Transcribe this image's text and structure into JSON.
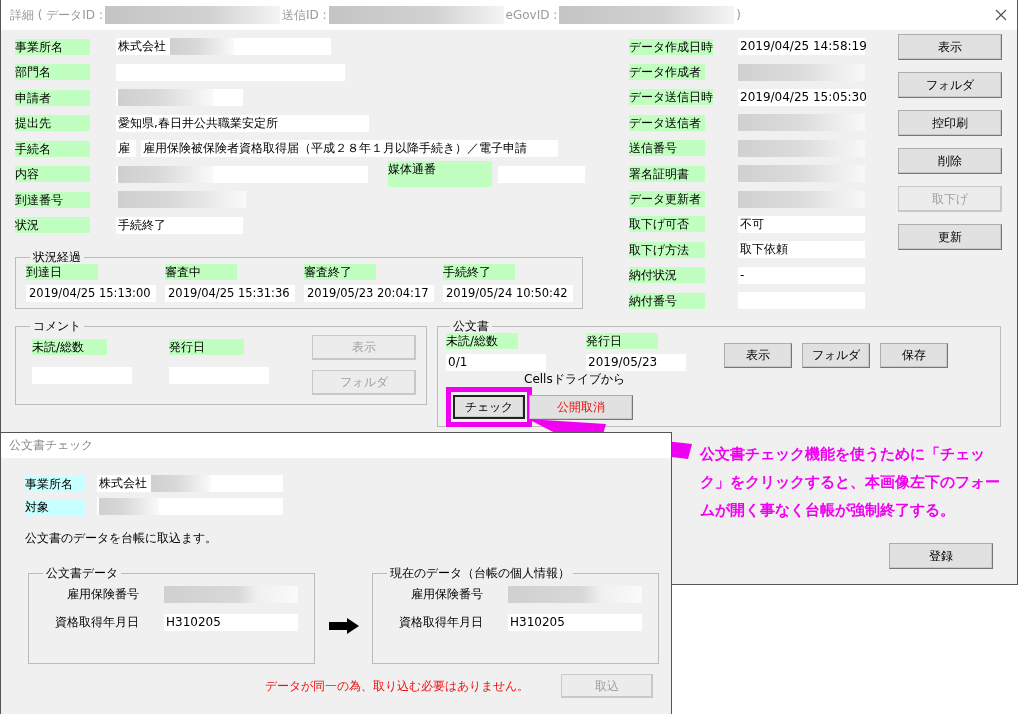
{
  "window": {
    "title_parts": [
      {
        "kind": "text",
        "text": "詳細 ( データID :"
      },
      {
        "kind": "redacted"
      },
      {
        "kind": "text",
        "text": "送信ID :"
      },
      {
        "kind": "redacted"
      },
      {
        "kind": "text",
        "text": "eGovID :"
      },
      {
        "kind": "redacted"
      },
      {
        "kind": "text",
        "text": ")"
      }
    ]
  },
  "left_fields": [
    {
      "label": "事業所名",
      "value": "株式会社",
      "redacted": true
    },
    {
      "label": "部門名"
    },
    {
      "label": "申請者",
      "redacted": true
    },
    {
      "label": "提出先",
      "value": "愛知県,春日井公共職業安定所"
    },
    {
      "label": "手続名",
      "code": "雇",
      "value": "雇用保険被保険者資格取得届（平成２８年１月以降手続き）／電子申請"
    },
    {
      "label": "内容",
      "redacted": true,
      "side_label": "媒体通番"
    },
    {
      "label": "到達番号",
      "redacted": true
    },
    {
      "label": "状況",
      "value": "手続終了"
    }
  ],
  "right_fields": [
    {
      "label": "データ作成日時",
      "value": "2019/04/25 14:58:19"
    },
    {
      "label": "データ作成者",
      "redacted": true
    },
    {
      "label": "データ送信日時",
      "value": "2019/04/25 15:05:30"
    },
    {
      "label": "データ送信者",
      "redacted": true
    },
    {
      "label": "送信番号",
      "redacted": true
    },
    {
      "label": "署名証明書",
      "redacted": true
    },
    {
      "label": "データ更新者",
      "redacted": true
    },
    {
      "label": "取下げ可否",
      "value": "不可"
    },
    {
      "label": "取下げ方法",
      "value": "取下依頼"
    },
    {
      "label": "納付状況",
      "value": "-"
    },
    {
      "label": "納付番号"
    }
  ],
  "side_buttons": [
    {
      "label": "表示",
      "disabled": false
    },
    {
      "label": "フォルダ",
      "disabled": false
    },
    {
      "label": "控印刷",
      "disabled": false
    },
    {
      "label": "削除",
      "disabled": false
    },
    {
      "label": "取下げ",
      "disabled": true
    },
    {
      "label": "更新",
      "disabled": false
    }
  ],
  "progress": {
    "title": "状況経過",
    "steps": [
      {
        "label": "到達日",
        "value": "2019/04/25 15:13:00"
      },
      {
        "label": "審査中",
        "value": "2019/04/25 15:31:36"
      },
      {
        "label": "審査終了",
        "value": "2019/05/23 20:04:17"
      },
      {
        "label": "手続終了",
        "value": "2019/05/24 10:50:42"
      }
    ]
  },
  "comment": {
    "title": "コメント",
    "fields": [
      {
        "label": "未読/総数"
      },
      {
        "label": "発行日"
      }
    ],
    "buttons": [
      {
        "label": "表示",
        "disabled": true
      },
      {
        "label": "フォルダ",
        "disabled": true
      }
    ]
  },
  "official": {
    "title": "公文書",
    "fields": [
      {
        "label": "未読/総数",
        "value": "0/1"
      },
      {
        "label": "発行日",
        "value": "2019/05/23"
      }
    ],
    "buttons": [
      {
        "label": "表示",
        "disabled": false
      },
      {
        "label": "フォルダ",
        "disabled": false
      },
      {
        "label": "保存",
        "disabled": false
      }
    ],
    "note": "Cellsドライブから",
    "actions": [
      {
        "label": "チェック",
        "kind": "normal",
        "highlighted": true
      },
      {
        "label": "公開取消",
        "kind": "danger",
        "highlighted": false
      }
    ]
  },
  "register_button": {
    "label": "登録",
    "disabled": false
  },
  "annotation": {
    "lines": [
      "公文書チェック機能を使うために「チェッ",
      "ク」をクリックすると、本画像左下のフォー",
      "ムが開く事なく台帳が強制終了する。"
    ]
  },
  "dialog": {
    "title": "公文書チェック",
    "fields": [
      {
        "label": "事業所名",
        "value": "株式会社",
        "redacted": true
      },
      {
        "label": "対象",
        "redacted": true
      }
    ],
    "message": "公文書のデータを台帳に取込ます。",
    "groups": [
      {
        "title": "公文書データ",
        "rows": [
          {
            "label": "雇用保険番号",
            "redacted": true
          },
          {
            "label": "資格取得年月日",
            "value": "H310205"
          }
        ]
      },
      {
        "title": "現在のデータ（台帳の個人情報）",
        "rows": [
          {
            "label": "雇用保険番号",
            "redacted": true
          },
          {
            "label": "資格取得年月日",
            "value": "H310205"
          }
        ]
      }
    ],
    "warning": "データが同一の為、取り込む必要はありません。",
    "import_button": {
      "label": "取込",
      "disabled": true
    }
  }
}
